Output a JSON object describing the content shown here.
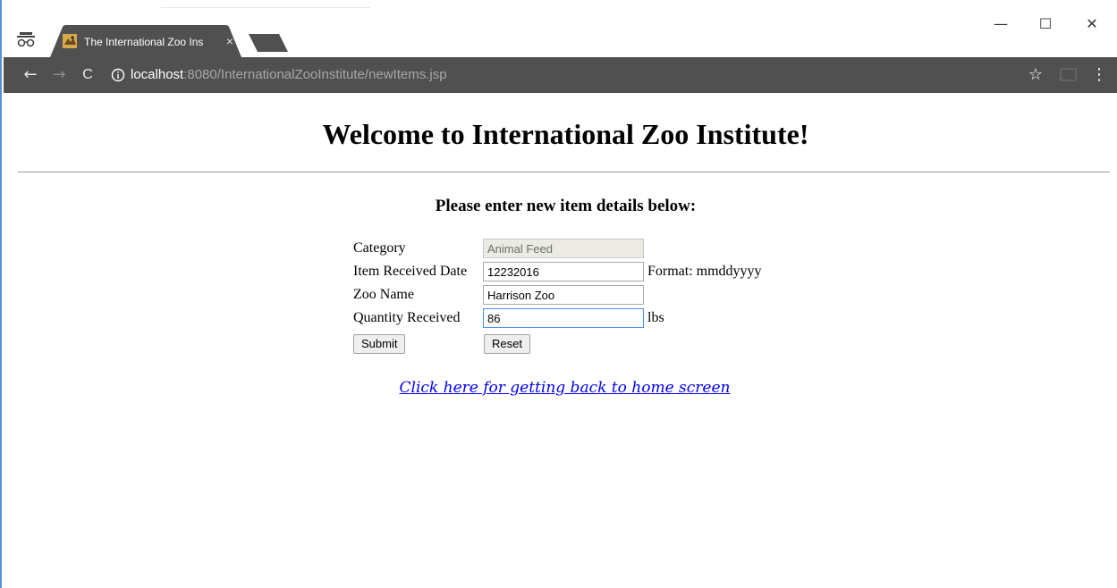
{
  "browser": {
    "tab": {
      "title": "The International Zoo Ins",
      "close_glyph": "×"
    },
    "window_controls": {
      "minimize": "—",
      "maximize": "☐",
      "close": "✕"
    },
    "nav": {
      "back": "←",
      "forward": "→",
      "reload": "C"
    },
    "url": {
      "host": "localhost",
      "rest": ":8080/InternationalZooInstitute/newItems.jsp"
    },
    "star": "☆",
    "menu": "⋮"
  },
  "page": {
    "title": "Welcome to International Zoo Institute!",
    "subtitle": "Please enter new item details below:",
    "form": {
      "category": {
        "label": "Category",
        "value": "Animal Feed",
        "disabled": true
      },
      "received_date": {
        "label": "Item Received Date",
        "value": "12232016",
        "hint": "Format: mmddyyyy"
      },
      "zoo_name": {
        "label": "Zoo Name",
        "value": "Harrison Zoo"
      },
      "quantity": {
        "label": "Quantity Received",
        "value": "86",
        "hint": "lbs"
      },
      "submit_label": "Submit",
      "reset_label": "Reset"
    },
    "home_link": "Click here for getting back to home screen"
  },
  "colors": {
    "toolbar": "#505050",
    "tab": "#505050",
    "link": "#0000ee",
    "focus": "#4d90fe"
  }
}
